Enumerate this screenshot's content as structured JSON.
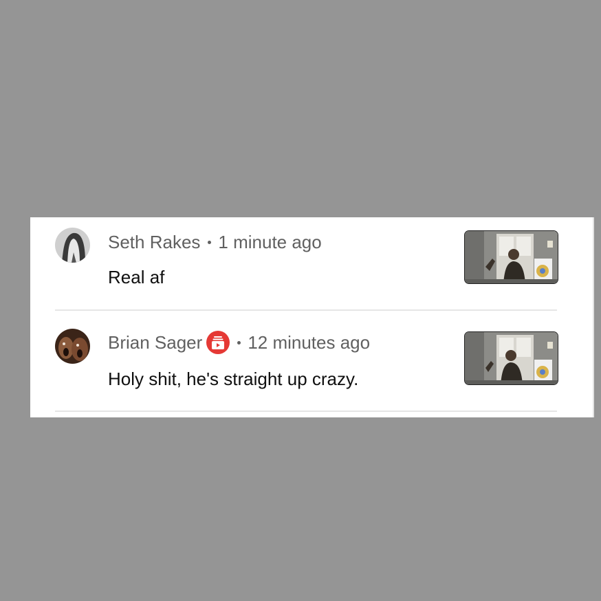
{
  "comments": [
    {
      "author": "Seth Rakes",
      "time": "1 minute ago",
      "text": "Real af",
      "has_badge": false,
      "avatar_icon": "user-avatar-grayscale",
      "thumbnail_icon": "video-thumbnail"
    },
    {
      "author": "Brian Sager",
      "time": "12 minutes ago",
      "text": "Holy shit, he's straight up crazy.",
      "has_badge": true,
      "badge_icon": "channel-member-badge-icon",
      "avatar_icon": "user-avatar",
      "thumbnail_icon": "video-thumbnail"
    }
  ],
  "colors": {
    "background": "#959595",
    "panel": "#ffffff",
    "meta_text": "#606060",
    "body_text": "#0f0f0f",
    "badge_red": "#e53935",
    "divider": "#e5e5e5"
  }
}
